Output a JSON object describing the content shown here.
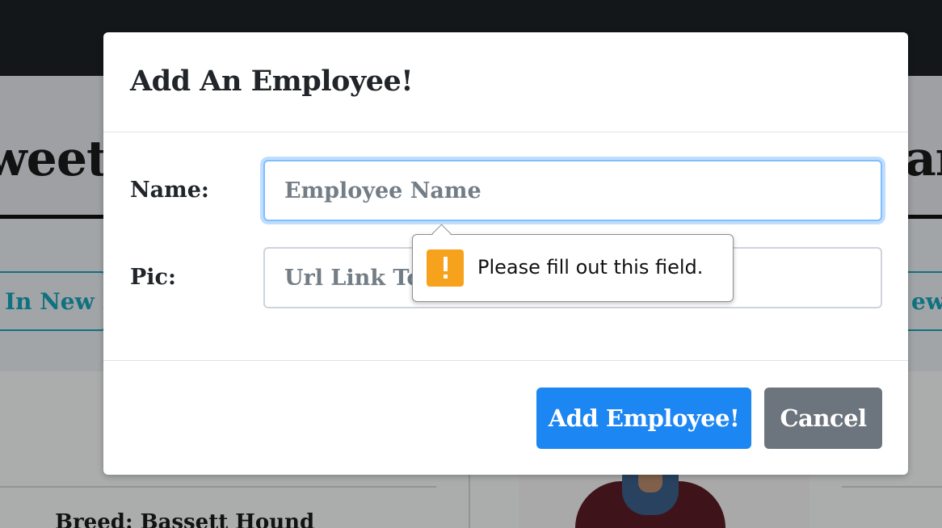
{
  "background": {
    "title_left": "weet",
    "title_right": "ar",
    "button_left_label": "In New P",
    "button_right_label": "ew",
    "card_text": "Breed: Bassett Hound"
  },
  "modal": {
    "title": "Add An Employee!",
    "fields": {
      "name": {
        "label": "Name:",
        "placeholder": "Employee Name",
        "value": ""
      },
      "pic": {
        "label": "Pic:",
        "placeholder": "Url Link To Employee Pic",
        "value": ""
      }
    },
    "buttons": {
      "add_label": "Add Employee!",
      "cancel_label": "Cancel"
    }
  },
  "validation_tooltip": {
    "message": "Please fill out this field.",
    "icon": "warning-icon"
  },
  "colors": {
    "primary": "#1c86f2",
    "secondary": "#6c757d",
    "warning": "#f7a21c",
    "info": "#17a2b8",
    "navbar": "#1d2125"
  }
}
